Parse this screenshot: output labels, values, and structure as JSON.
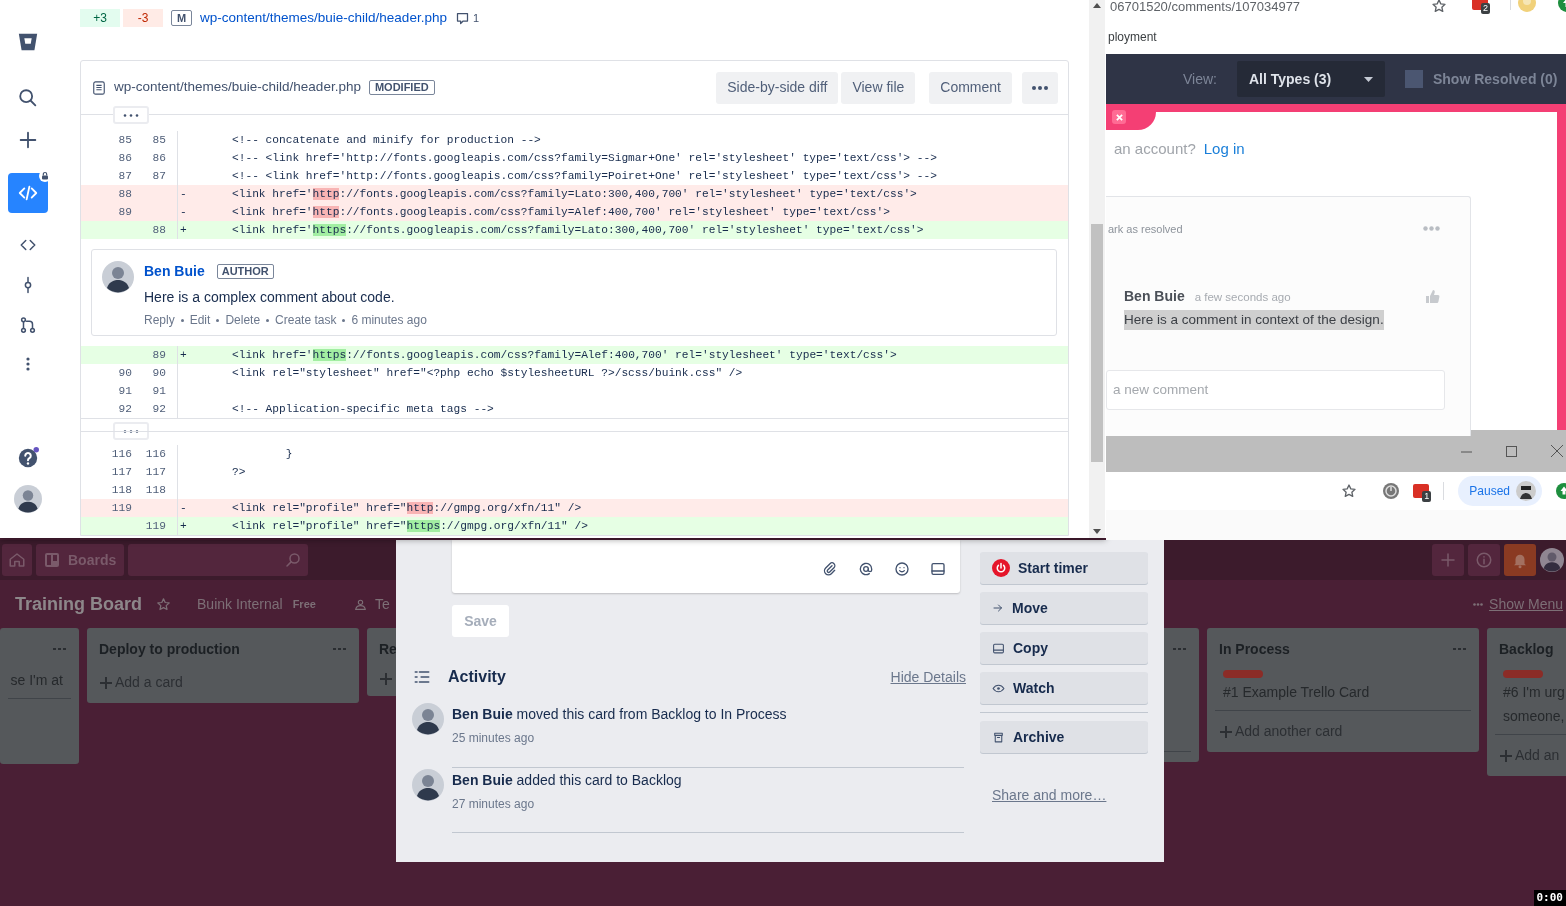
{
  "bitbucket": {
    "nav": [
      {
        "kind": "logo",
        "selected": false
      },
      {
        "kind": "search",
        "selected": false
      },
      {
        "kind": "create",
        "selected": false
      },
      {
        "kind": "source",
        "selected": true
      },
      {
        "kind": "code",
        "selected": false
      },
      {
        "kind": "commits",
        "selected": false
      },
      {
        "kind": "pull-requests",
        "selected": false
      },
      {
        "kind": "more",
        "selected": false
      }
    ],
    "nav_bottom": [
      {
        "kind": "help",
        "selected": false
      },
      {
        "kind": "avatar",
        "selected": false
      }
    ],
    "file_summary": {
      "added": "+3",
      "removed": "-3",
      "status": "M",
      "path": "wp-content/themes/buie-child/header.php",
      "comment_count": "1"
    },
    "file": {
      "path": "wp-content/themes/buie-child/header.php",
      "status": "MODIFIED",
      "actions": [
        "Side-by-side diff",
        "View file",
        "Comment"
      ],
      "hunks": [
        {
          "rows": [
            {
              "kind": "context",
              "old": "85",
              "new": "85",
              "code": "<!-- concatenate and minify for production -->"
            },
            {
              "kind": "context",
              "old": "86",
              "new": "86",
              "code": "<!-- <link href='http://fonts.googleapis.com/css?family=Sigmar+One' rel='stylesheet' type='text/css'> -->"
            },
            {
              "kind": "context",
              "old": "87",
              "new": "87",
              "code": "<!-- <link href='http://fonts.googleapis.com/css?family=Poiret+One' rel='stylesheet' type='text/css'> -->"
            },
            {
              "kind": "removed",
              "old": "88",
              "sign": "-",
              "code": "<link href='",
              "changed": "http",
              "code_end": "://fonts.googleapis.com/css?family=Lato:300,400,700' rel='stylesheet' type='text/css'>"
            },
            {
              "kind": "removed",
              "old": "89",
              "sign": "-",
              "code": "<link href='",
              "changed": "http",
              "code_end": "://fonts.googleapis.com/css?family=Alef:400,700' rel='stylesheet' type='text/css'>"
            },
            {
              "kind": "added",
              "new": "88",
              "sign": "+",
              "code": "<link href='",
              "changed": "https",
              "code_end": "://fonts.googleapis.com/css?family=Lato:300,400,700' rel='stylesheet' type='text/css'>"
            },
            {
              "kind": "comment",
              "author": "Ben Buie",
              "role": "AUTHOR",
              "text": "Here is a complex comment about code.",
              "actions": [
                "Reply",
                "Edit",
                "Delete",
                "Create task"
              ],
              "time": "6 minutes ago"
            },
            {
              "kind": "added",
              "new": "89",
              "sign": "+",
              "code": "<link href='",
              "changed": "https",
              "code_end": "://fonts.googleapis.com/css?family=Alef:400,700' rel='stylesheet' type='text/css'>"
            },
            {
              "kind": "context",
              "old": "90",
              "new": "90",
              "code": "<link rel=\"stylesheet\" href=\"<?php echo $stylesheetURL ?>/scss/buink.css\" />"
            },
            {
              "kind": "context",
              "old": "91",
              "new": "91"
            },
            {
              "kind": "context",
              "old": "92",
              "new": "92",
              "code": "<!-- Application-specific meta tags -->"
            }
          ]
        },
        {
          "rows": [
            {
              "kind": "context",
              "old": "116",
              "new": "116",
              "code": "        }"
            },
            {
              "kind": "context",
              "old": "117",
              "new": "117",
              "code": "?>"
            },
            {
              "kind": "context",
              "old": "118",
              "new": "118"
            },
            {
              "kind": "removed",
              "old": "119",
              "sign": "-",
              "code": "<link rel=\"profile\" href=\"",
              "changed": "http",
              "code_end": "://gmpg.org/xfn/11\" />"
            },
            {
              "kind": "added",
              "new": "119",
              "sign": "+",
              "code": "<link rel=\"profile\" href=\"",
              "changed": "https",
              "code_end": "://gmpg.org/xfn/11\" />"
            }
          ]
        }
      ]
    }
  },
  "review_window": {
    "url": "06701520/comments/107034977",
    "extension_badge": "2",
    "bookmark": "ployment",
    "view_label": "View:",
    "view_filter": "All Types (3)",
    "show_resolved": {
      "label": "Show Resolved (0)",
      "checked": false
    },
    "prompt": "an account?",
    "login": "Log in",
    "comment": {
      "action": "ark as resolved",
      "author": "Ben Buie",
      "time": "a few seconds ago",
      "text": "Here is a comment in context of the design.",
      "reply_placeholder": "a new comment"
    }
  },
  "browser_toolbar": {
    "extension_badge": "1",
    "profile": "Paused"
  },
  "trello": {
    "header": {
      "boards": "Boards"
    },
    "board": {
      "title": "Training Board",
      "team": "Buink Internal",
      "plan": "Free",
      "visibility": "Te",
      "menu": "Show Menu"
    },
    "lists_left": [
      {
        "kind": "clipped",
        "cards": [
          {
            "lines": [
              "se I'm at"
            ],
            "labeled": false
          }
        ]
      },
      {
        "kind": "full",
        "title": "Deploy to production",
        "add": "Add a card"
      },
      {
        "kind": "full",
        "title": "Re"
      }
    ],
    "lists_right": [
      {
        "kind": "covered"
      },
      {
        "kind": "full",
        "title": "In Process",
        "cards": [
          {
            "lines": [
              "#1 Example Trello Card"
            ],
            "labeled": true
          }
        ],
        "add": "Add another card"
      },
      {
        "kind": "full",
        "title": "Backlog",
        "cards": [
          {
            "lines": [
              "#6 I'm urg",
              "someone,"
            ],
            "labeled": true
          }
        ],
        "add": "Add an"
      }
    ]
  },
  "card_modal": {
    "save": "Save",
    "activity": {
      "title": "Activity",
      "toggle": "Hide Details",
      "items": [
        {
          "author": "Ben Buie",
          "action": "moved this card from Backlog to In Process",
          "time": "25 minutes ago"
        },
        {
          "author": "Ben Buie",
          "action": "added this card to Backlog",
          "time": "27 minutes ago"
        }
      ]
    },
    "actions": [
      {
        "kind": "timer",
        "label": "Start timer"
      },
      {
        "kind": "move",
        "label": "Move"
      },
      {
        "kind": "copy",
        "label": "Copy"
      },
      {
        "kind": "watch",
        "label": "Watch"
      }
    ],
    "secondary_actions": [
      {
        "kind": "archive",
        "label": "Archive"
      }
    ],
    "share": "Share and more…"
  },
  "recorder": {
    "time": "0:00"
  }
}
